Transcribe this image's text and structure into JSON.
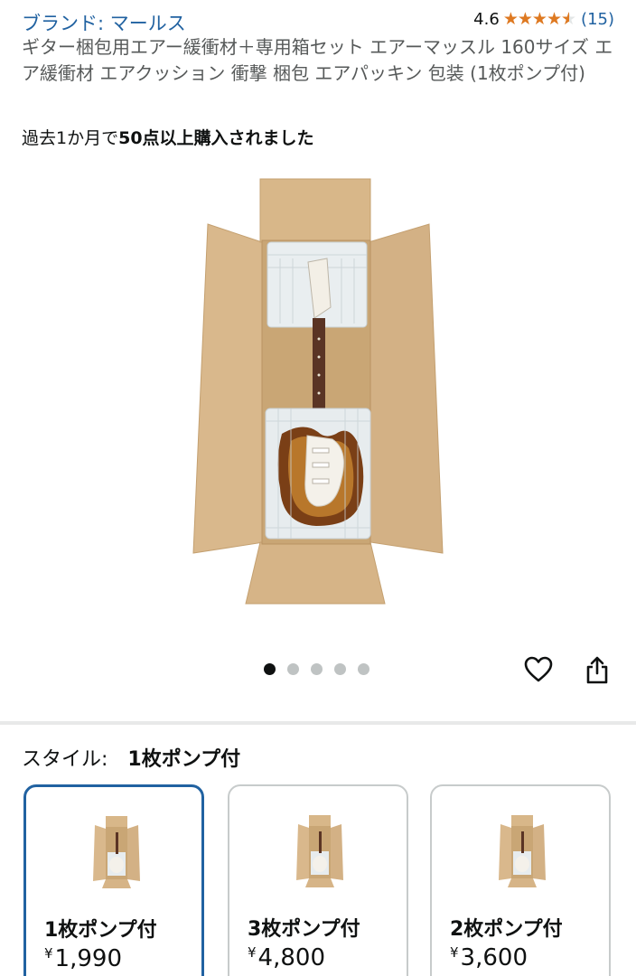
{
  "header": {
    "brand_link": "ブランド: マールス",
    "rating_value": "4.6",
    "review_count": "(15)"
  },
  "rating": {
    "stars": 4.6,
    "max": 5
  },
  "product": {
    "title": "ギター梱包用エアー緩衝材＋専用箱セット エアーマッスル 160サイズ エア緩衝材 エアクッション 衝撃 梱包 エアパッキン 包装 (1枚ポンプ付)",
    "social_prefix": "過去1か月で",
    "social_bold": "50点以上購入されました"
  },
  "carousel": {
    "total": 5,
    "active_index": 0
  },
  "icons": {
    "wishlist": "heart-icon",
    "share": "share-icon",
    "star": "star-icon"
  },
  "style_selector": {
    "label": "スタイル:",
    "selected_value": "1枚ポンプ付",
    "options": [
      {
        "label": "1枚ポンプ付",
        "currency": "¥",
        "price": "1,990",
        "selected": true
      },
      {
        "label": "3枚ポンプ付",
        "currency": "¥",
        "price": "4,800",
        "selected": false
      },
      {
        "label": "2枚ポンプ付",
        "currency": "¥",
        "price": "3,600",
        "selected": false
      }
    ]
  },
  "colors": {
    "link": "#2162a1",
    "star": "#de7921",
    "selected_border": "#2162a1",
    "cardboard": "#d4b184"
  }
}
